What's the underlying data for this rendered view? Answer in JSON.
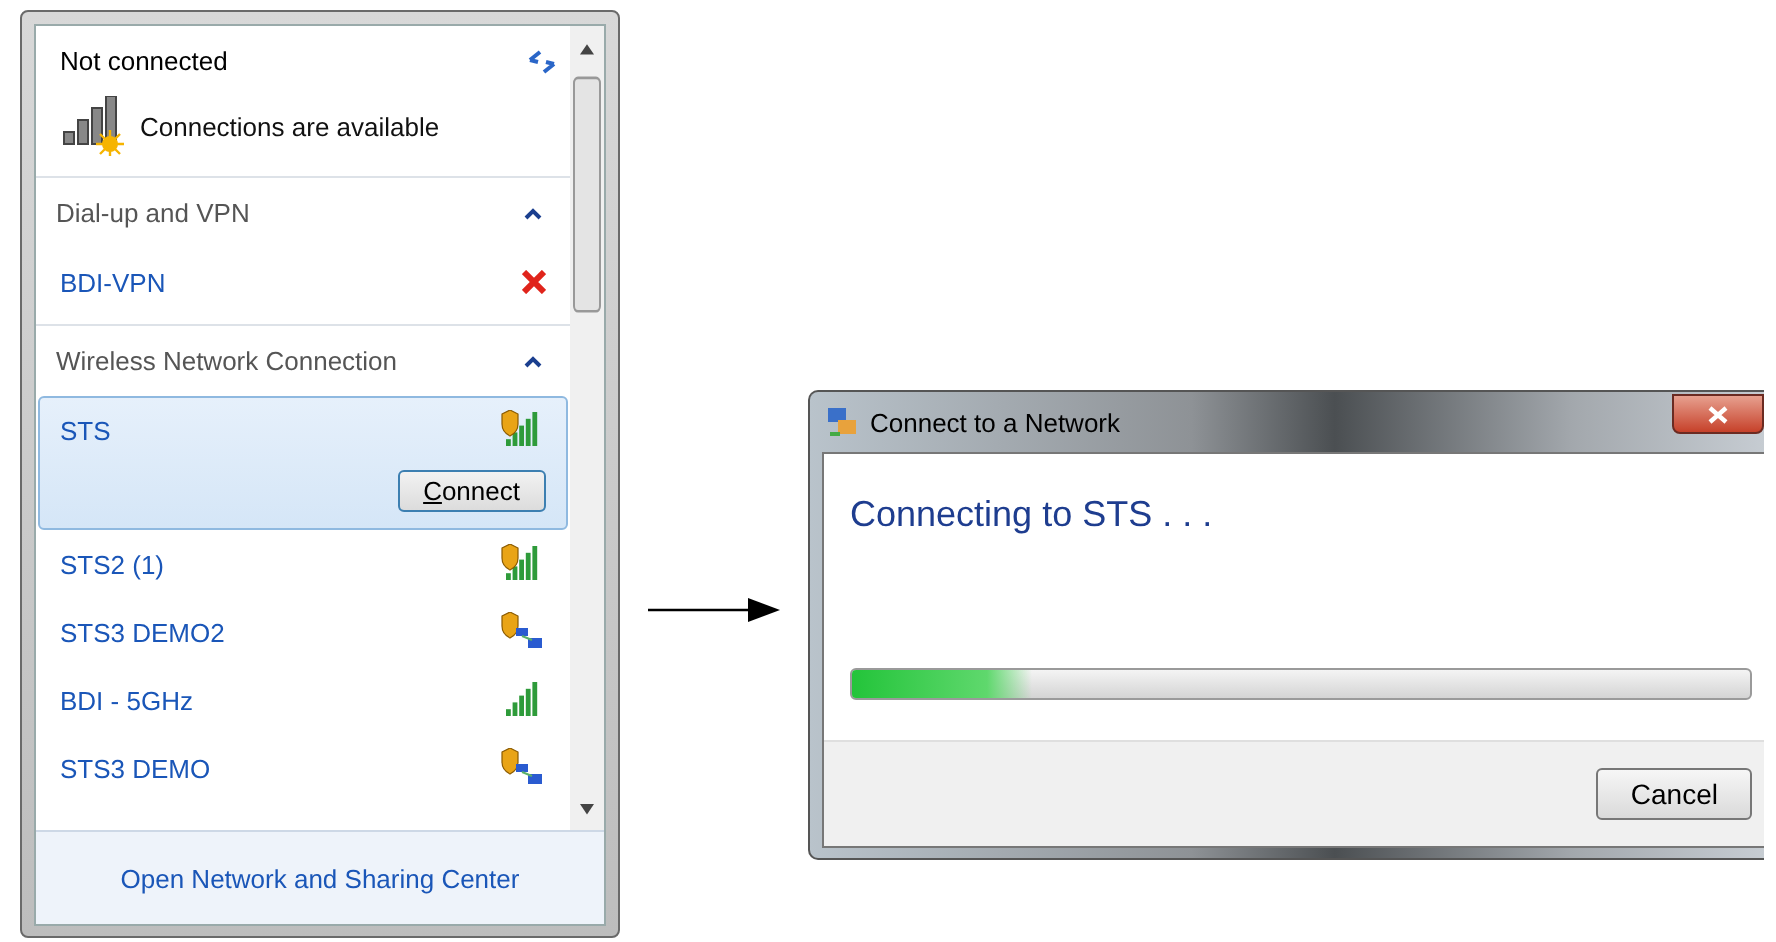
{
  "network_panel": {
    "status": "Not connected",
    "availability": "Connections are available",
    "groups": [
      {
        "title": "Dial-up and VPN",
        "expanded": true,
        "items": [
          {
            "name": "BDI-VPN",
            "kind": "vpn",
            "selected": false
          }
        ]
      },
      {
        "title": "Wireless Network Connection",
        "expanded": true,
        "items": [
          {
            "name": "STS",
            "kind": "secured",
            "selected": true
          },
          {
            "name": "STS2 (1)",
            "kind": "secured",
            "selected": false
          },
          {
            "name": "STS3 DEMO2",
            "kind": "adhoc",
            "selected": false
          },
          {
            "name": "BDI - 5GHz",
            "kind": "open",
            "selected": false
          },
          {
            "name": "STS3 DEMO",
            "kind": "adhoc",
            "selected": false
          }
        ]
      }
    ],
    "connect_button": "Connect",
    "footer_link": "Open Network and Sharing Center"
  },
  "dialog": {
    "title": "Connect to a Network",
    "message": "Connecting to STS . . .",
    "progress": {
      "level": 0.2
    },
    "cancel_button": "Cancel"
  }
}
